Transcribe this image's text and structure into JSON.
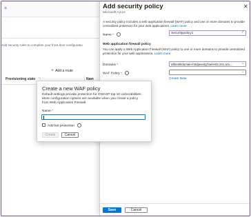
{
  "background_page": {
    "title": "",
    "close_glyph": "×",
    "description": "Add security rules to complete your front door configuratio",
    "add_route_label": "Add a route",
    "add_route_icon": "plus-icon",
    "columns": [
      "Provisioning state",
      "Nam"
    ],
    "sort_glyph": "↑↓"
  },
  "panel": {
    "title": "Add security policy",
    "subtitle": "Microsoft Azure",
    "close_glyph": "✕",
    "description": "A security policy includes a web application firewall (WAF) policy and one or more domains to provide centralized protection for your web applications.",
    "learn_more": "Learn more",
    "name_label": "Name",
    "name_value": "Securitypolicy1",
    "valid_glyph": "✓",
    "waf_heading": "Web application firewall policy",
    "waf_description": "You can apply a Web Application Firewall (WAF) policy to one or more domains to provide centralized protection for your web applications.",
    "domains_label": "Domains",
    "domains_value": "afdentitldomain-h3djane0g7aehmf4.z01.azu...",
    "waf_policy_label": "WAF Policy",
    "create_new": "Create New",
    "save": "Save",
    "cancel": "Cancel",
    "required_mark": "*",
    "chevron_glyph": "⌄"
  },
  "modal": {
    "title": "Create a new WAF policy",
    "description": "Default settings provide protection for OWASP top 10 vulnerabilities. More configuration options are available when you create a policy from Web Application Firewall.",
    "name_label": "Name",
    "name_value": "",
    "bot_protection_label": "Add bot protection",
    "bot_protection_checked": false,
    "create": "Create",
    "cancel": "Cancel",
    "required_mark": "*"
  },
  "colors": {
    "accent": "#0078d4",
    "frame": "#6b4fa0",
    "required": "#a4262c",
    "link": "#0067b8"
  }
}
